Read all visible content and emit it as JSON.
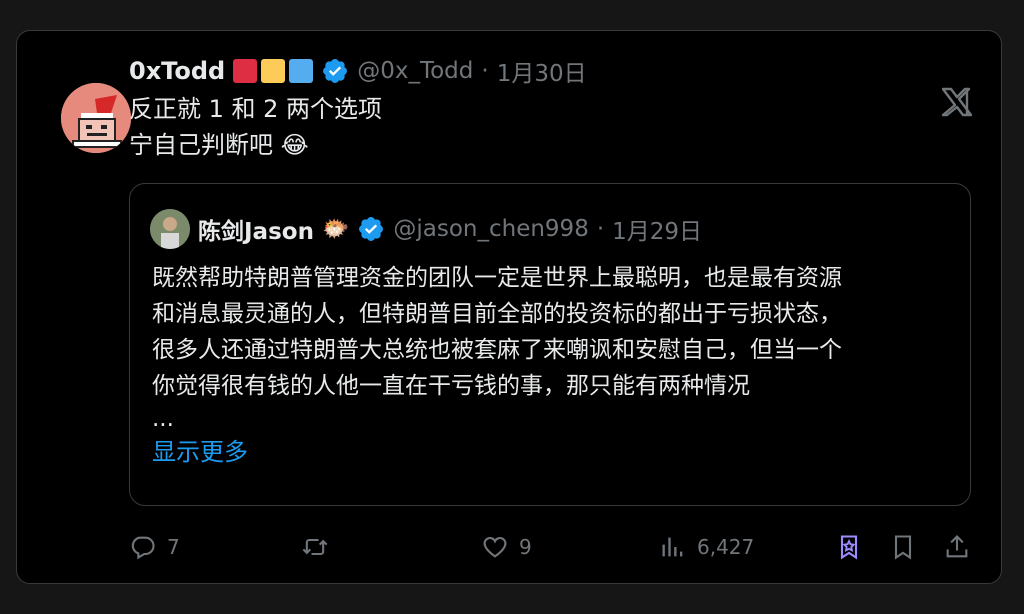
{
  "tweet": {
    "author_name": "0xTodd",
    "handle": "@0x_Todd",
    "date_sep": "·",
    "date": "1月30日",
    "badge_colors": [
      "#dd2e44",
      "#fdcb58",
      "#55acee"
    ],
    "text_lines": [
      "反正就 1 和 2 两个选项",
      "宁自己判断吧 😂"
    ]
  },
  "quote": {
    "author_name": "陈剑Jason",
    "emoji": "🐡",
    "handle": "@jason_chen998",
    "date_sep": "·",
    "date": "1月29日",
    "text_lines": [
      "既然帮助特朗普管理资金的团队一定是世界上最聪明，也是最有资源",
      "和消息最灵通的人，但特朗普目前全部的投资标的都出于亏损状态，",
      "很多人还通过特朗普大总统也被套麻了来嘲讽和安慰自己，但当一个",
      "你觉得很有钱的人他一直在干亏钱的事，那只能有两种情况",
      "..."
    ],
    "show_more": "显示更多"
  },
  "actions": {
    "reply_count": "7",
    "retweet_count": "",
    "like_count": "9",
    "views_count": "6,427"
  },
  "icons": [
    "x-logo-icon",
    "verified-icon",
    "reply-icon",
    "retweet-icon",
    "like-icon",
    "views-icon",
    "grok-icon",
    "bookmark-icon",
    "share-icon"
  ],
  "colors": {
    "accent": "#1d9bf0",
    "muted": "#71767b",
    "text": "#e7e9ea",
    "grok": "#9b8cff"
  }
}
